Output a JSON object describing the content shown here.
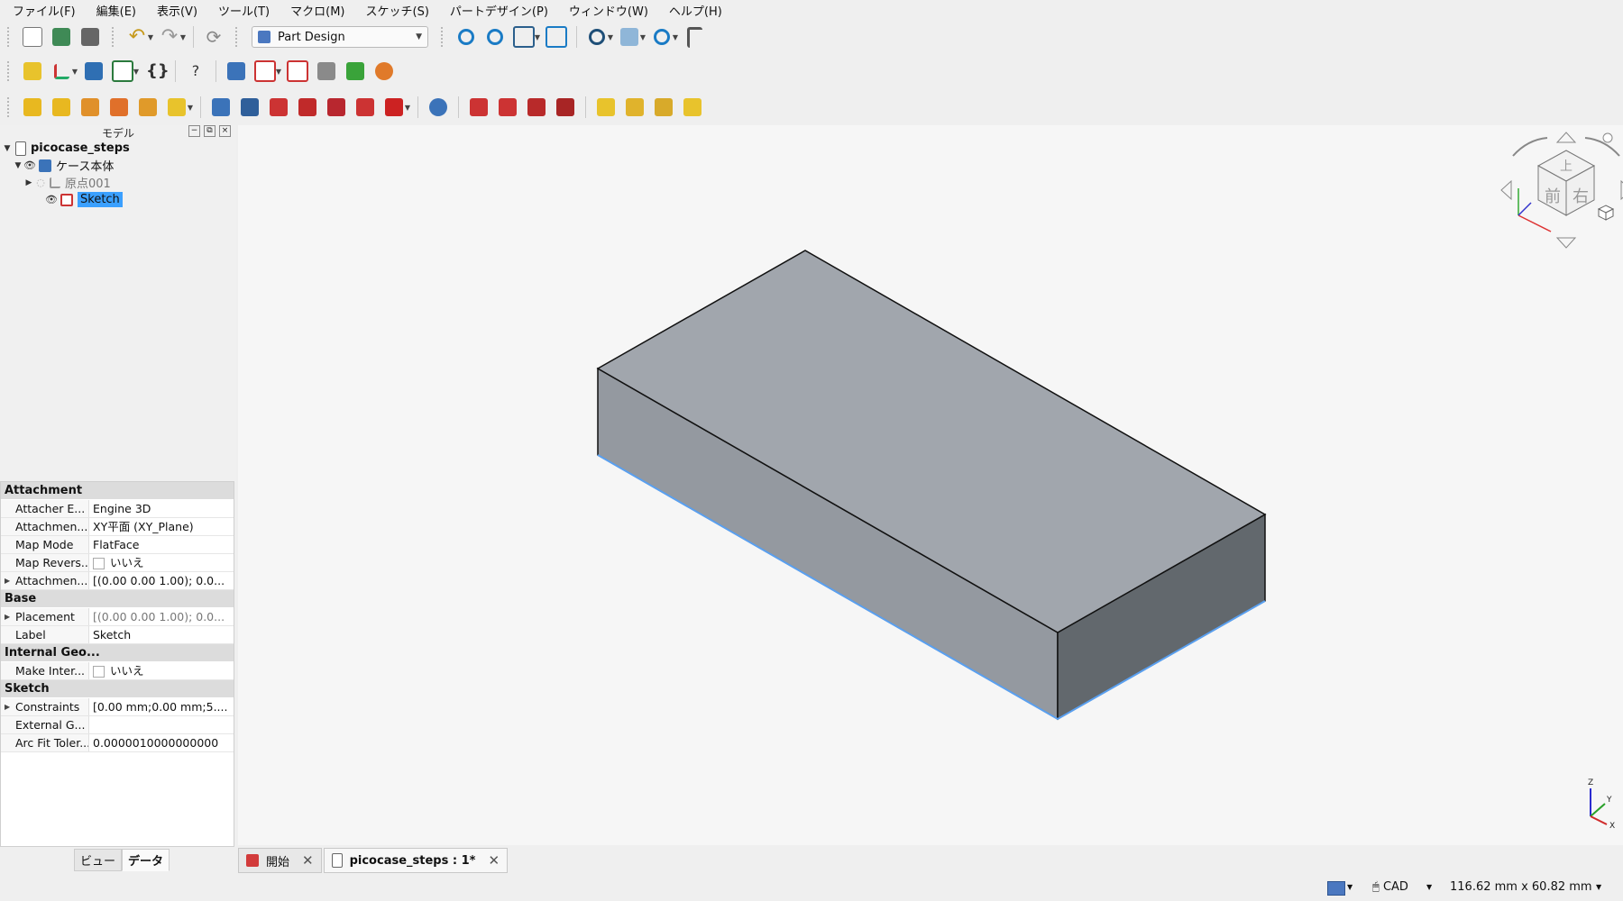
{
  "menu": [
    "ファイル(F)",
    "編集(E)",
    "表示(V)",
    "ツール(T)",
    "マクロ(M)",
    "スケッチ(S)",
    "パートデザイン(P)",
    "ウィンドウ(W)",
    "ヘルプ(H)"
  ],
  "workbench": {
    "selected": "Part Design"
  },
  "tree": {
    "panel_title": "モデル",
    "document": "picocase_steps",
    "body": "ケース本体",
    "origin": "原点001",
    "sketch": "Sketch"
  },
  "properties": {
    "groups": [
      {
        "name": "Attachment",
        "rows": [
          {
            "name": "Attacher E...",
            "value": "Engine 3D"
          },
          {
            "name": "Attachmen...",
            "value": "XY平面 (XY_Plane)"
          },
          {
            "name": "Map Mode",
            "value": "FlatFace"
          },
          {
            "name": "Map Revers...",
            "value": "いいえ",
            "checkbox": true
          },
          {
            "name": "Attachmen...",
            "value": "[(0.00 0.00 1.00); 0.0...",
            "expandable": true
          }
        ]
      },
      {
        "name": "Base",
        "rows": [
          {
            "name": "Placement",
            "value": "[(0.00 0.00 1.00); 0.0...",
            "expandable": true,
            "dim": true
          },
          {
            "name": "Label",
            "value": "Sketch"
          }
        ]
      },
      {
        "name": "Internal Geo...",
        "rows": [
          {
            "name": "Make Inter...",
            "value": "いいえ",
            "checkbox": true
          }
        ]
      },
      {
        "name": "Sketch",
        "rows": [
          {
            "name": "Constraints",
            "value": "[0.00 mm;0.00 mm;5....",
            "expandable": true
          },
          {
            "name": "External G...",
            "value": ""
          },
          {
            "name": "Arc Fit Toler...",
            "value": "0.0000010000000000"
          }
        ]
      }
    ],
    "tabs": [
      "ビュー",
      "データ"
    ]
  },
  "navcube": {
    "top": "上",
    "front": "前",
    "right": "右"
  },
  "axis": {
    "z": "Z",
    "y": "Y",
    "x": "X"
  },
  "doc_tabs": [
    {
      "label": "開始"
    },
    {
      "label": "picocase_steps : 1*"
    }
  ],
  "status": {
    "nav_style": "CAD",
    "dimensions": "116.62 mm x 60.82 mm"
  },
  "colors": {
    "selection": "#3ba0ff",
    "box_top": "#a1a6ad",
    "box_front": "#9499a0",
    "box_right": "#62686d",
    "edge_highlight": "#5aa0f0"
  }
}
